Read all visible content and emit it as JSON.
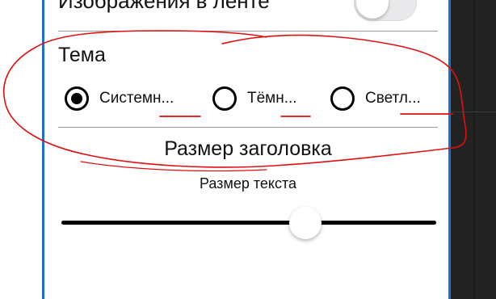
{
  "settings": {
    "feed_images_label": "Изображения в ленте",
    "feed_images_enabled": false,
    "theme": {
      "title": "Тема",
      "options": [
        {
          "label": "Системн...",
          "selected": true
        },
        {
          "label": "Тёмн...",
          "selected": false
        },
        {
          "label": "Светл...",
          "selected": false
        }
      ]
    },
    "heading_size_label": "Размер заголовка",
    "text_size_label": "Размер текста",
    "text_size_slider_value": 0.65
  },
  "colors": {
    "accent_frame": "#1f6fd1",
    "annotation": "#e01010",
    "dark_panel": "#222222"
  },
  "icons": {
    "selected_radio": "radio-selected-icon",
    "unselected_radio": "radio-unselected-icon"
  }
}
